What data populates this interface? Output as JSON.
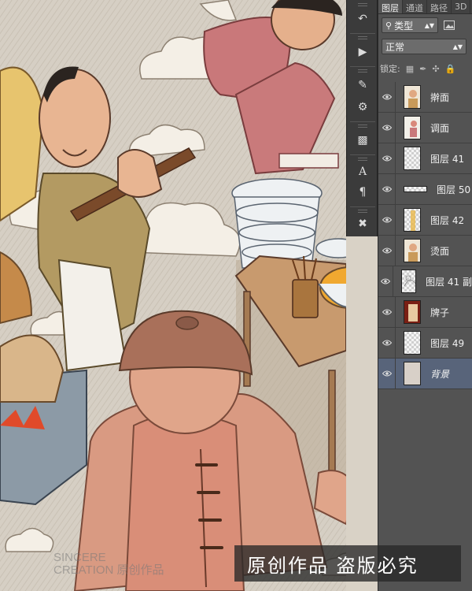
{
  "panel": {
    "tabs": [
      "图层",
      "通道",
      "路径",
      "3D"
    ],
    "filter_label": "类型",
    "blend_mode": "正常",
    "lock_label": "锁定:"
  },
  "layers": [
    {
      "name": "擀面",
      "thumb": "figure"
    },
    {
      "name": "调面",
      "thumb": "figure-small"
    },
    {
      "name": "图层 41",
      "thumb": "blank"
    },
    {
      "name": "图层 50",
      "thumb": "strip"
    },
    {
      "name": "图层 42",
      "thumb": "blank-yellow"
    },
    {
      "name": "烫面",
      "thumb": "figure"
    },
    {
      "name": "图层 41 副",
      "thumb": "sketch"
    },
    {
      "name": "牌子",
      "thumb": "sign"
    },
    {
      "name": "图层 49",
      "thumb": "blank"
    },
    {
      "name": "背景",
      "thumb": "background",
      "selected": true
    }
  ],
  "overlay": {
    "watermark_text": "原创作品 盗版必究",
    "brand_line1": "SINCERE",
    "brand_line2": "CREATION 原创作品"
  },
  "colors": {
    "panel_bg": "#535353",
    "selected_row": "#58647a",
    "toolbar_bg": "#3b3b3b"
  },
  "icons": {
    "toolbar": [
      "history-icon",
      "play-icon",
      "brush-preset-icon",
      "tool-preset-icon",
      "clone-source-icon",
      "character-icon",
      "paragraph-icon",
      "tools-icon"
    ]
  }
}
